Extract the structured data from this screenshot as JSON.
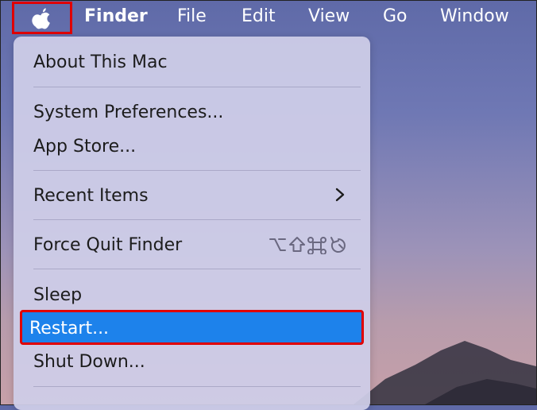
{
  "menubar": {
    "apple_icon": "apple-logo-icon",
    "items": [
      "Finder",
      "File",
      "Edit",
      "View",
      "Go",
      "Window"
    ]
  },
  "apple_menu": {
    "items": {
      "about": "About This Mac",
      "system_preferences": "System Preferences...",
      "app_store": "App Store...",
      "recent_items": "Recent Items",
      "force_quit": "Force Quit Finder",
      "sleep": "Sleep",
      "restart": "Restart...",
      "shut_down": "Shut Down..."
    },
    "recent_items_submenu_icon": "chevron-right-icon",
    "force_quit_shortcut_icons": [
      "option-key-icon",
      "shift-key-icon",
      "command-key-icon",
      "escape-key-icon"
    ]
  },
  "colors": {
    "highlight": "#1d82eb",
    "annotation_border": "#e00000",
    "menu_background": "#cecde8",
    "desktop_top": "#5f6aa8",
    "desktop_bottom": "#c7a0a8"
  }
}
